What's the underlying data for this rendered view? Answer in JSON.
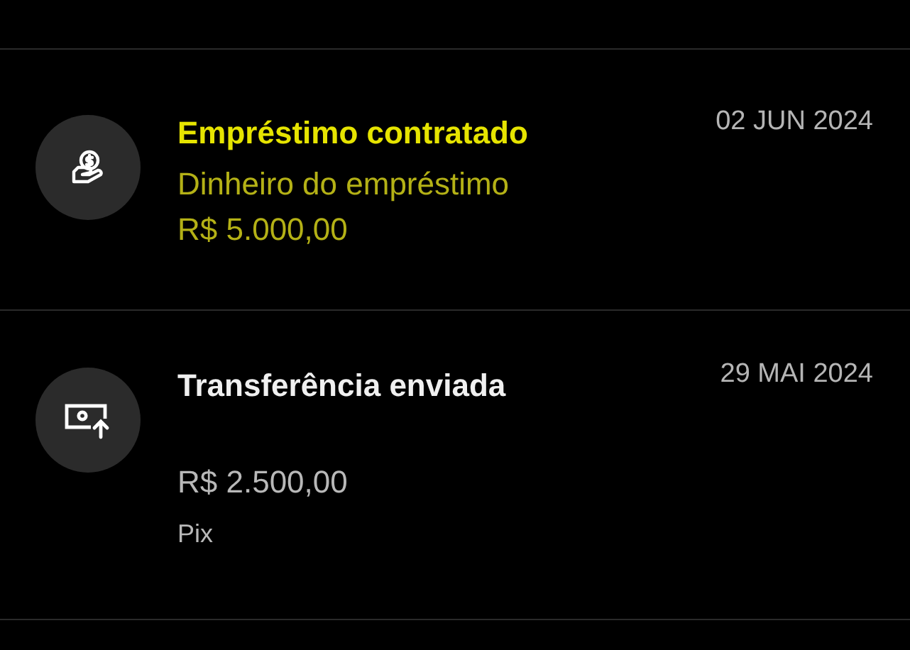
{
  "transactions": [
    {
      "kind": "loan",
      "title": "Empréstimo contratado",
      "subtitle": "Dinheiro do empréstimo",
      "amount": "R$ 5.000,00",
      "date": "02 JUN 2024"
    },
    {
      "kind": "transfer",
      "title": "Transferência enviada",
      "amount": "R$ 2.500,00",
      "method": "Pix",
      "date": "29 MAI 2024"
    }
  ]
}
